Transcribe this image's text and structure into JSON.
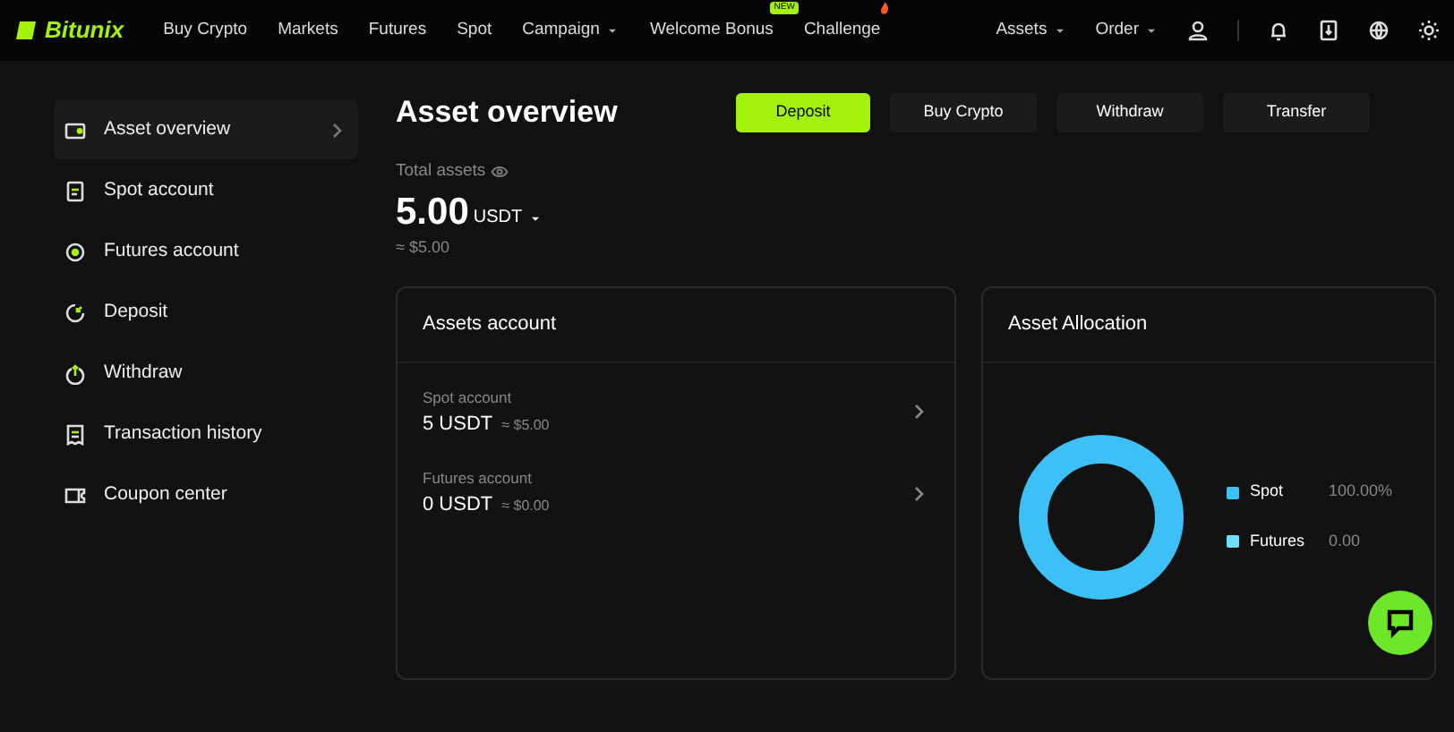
{
  "brand": "Bitunix",
  "nav": [
    {
      "label": "Buy Crypto"
    },
    {
      "label": "Markets"
    },
    {
      "label": "Futures"
    },
    {
      "label": "Spot"
    },
    {
      "label": "Campaign",
      "dropdown": true
    },
    {
      "label": "Welcome Bonus",
      "badge": "NEW"
    },
    {
      "label": "Challenge",
      "hot": true
    }
  ],
  "nav_right": [
    {
      "label": "Assets",
      "dropdown": true
    },
    {
      "label": "Order",
      "dropdown": true
    }
  ],
  "sidebar": [
    {
      "label": "Asset overview",
      "kind": "wallet",
      "selected": true
    },
    {
      "label": "Spot account",
      "kind": "doc",
      "selected": false
    },
    {
      "label": "Futures account",
      "kind": "target",
      "selected": false
    },
    {
      "label": "Deposit",
      "kind": "deposit",
      "selected": false
    },
    {
      "label": "Withdraw",
      "kind": "withdraw",
      "selected": false
    },
    {
      "label": "Transaction history",
      "kind": "receipt",
      "selected": false
    },
    {
      "label": "Coupon center",
      "kind": "coupon",
      "selected": false
    }
  ],
  "title": "Asset overview",
  "actions": [
    {
      "label": "Deposit",
      "primary": true
    },
    {
      "label": "Buy Crypto",
      "primary": false
    },
    {
      "label": "Withdraw",
      "primary": false
    },
    {
      "label": "Transfer",
      "primary": false
    }
  ],
  "total": {
    "label": "Total assets",
    "amount": "5.00",
    "unit": "USDT",
    "fiat": "≈ $5.00"
  },
  "accounts": {
    "title": "Assets account",
    "items": [
      {
        "name": "Spot account",
        "amount": "5 USDT",
        "fiat": "≈ $5.00"
      },
      {
        "name": "Futures account",
        "amount": "0 USDT",
        "fiat": "≈ $0.00"
      }
    ]
  },
  "allocation": {
    "title": "Asset Allocation",
    "legend": [
      {
        "name": "Spot",
        "value": "100.00%",
        "color": "#3cc0f5"
      },
      {
        "name": "Futures",
        "value": "0.00",
        "color": "#6fe0f5"
      }
    ]
  }
}
